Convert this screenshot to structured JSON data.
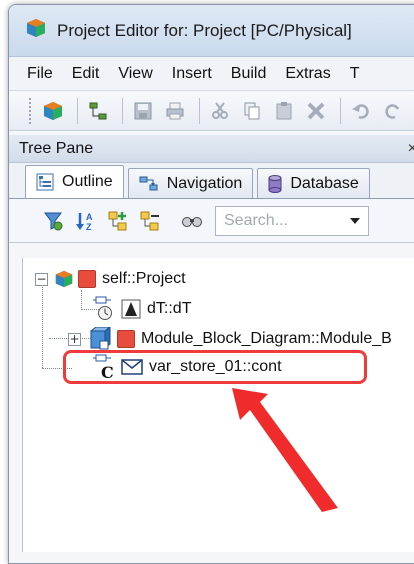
{
  "window": {
    "title": "Project Editor for: Project [PC/Physical]"
  },
  "menu": [
    "File",
    "Edit",
    "View",
    "Insert",
    "Build",
    "Extras",
    "T"
  ],
  "toolbar": {
    "icons": [
      "project-icon",
      "hierarchy-icon",
      "save-icon",
      "print-icon",
      "cut-icon",
      "copy-icon",
      "paste-icon",
      "delete-icon",
      "undo-icon",
      "redo-icon"
    ]
  },
  "tree_pane": {
    "title": "Tree Pane",
    "close": "×",
    "tabs": [
      {
        "label": "Outline",
        "icon": "outline-icon",
        "active": true
      },
      {
        "label": "Navigation",
        "icon": "navigation-icon",
        "active": false
      },
      {
        "label": "Database",
        "icon": "database-icon",
        "active": false
      }
    ],
    "search_placeholder": "Search..."
  },
  "tree": {
    "nodes": [
      {
        "label": "self::Project",
        "expander": "−"
      },
      {
        "label": "dT::dT"
      },
      {
        "label": "Module_Block_Diagram::Module_B",
        "expander": "+"
      },
      {
        "label": "var_store_01::cont",
        "prefix": "C"
      }
    ]
  },
  "colors": {
    "highlight": "#ef3b3b",
    "arrow": "#ef2b2b"
  }
}
